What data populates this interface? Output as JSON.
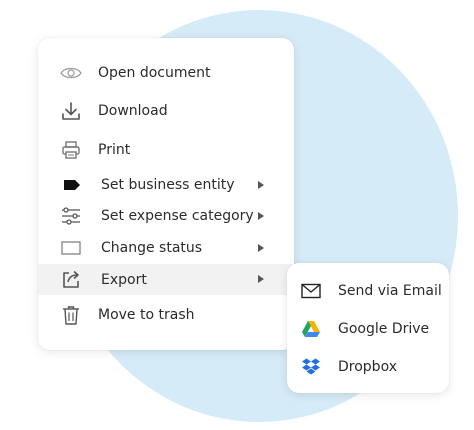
{
  "colors": {
    "background_circle": "#d6ebf8",
    "text": "#2b2b2b",
    "icon": "#555555",
    "highlight": "#f2f2f2",
    "dropbox": "#1f6fe0"
  },
  "menu": {
    "items": [
      {
        "label": "Open document",
        "icon": "eye-icon"
      },
      {
        "label": "Download",
        "icon": "download-icon"
      },
      {
        "label": "Print",
        "icon": "printer-icon"
      },
      {
        "label": "Set business entity",
        "icon": "tag-icon",
        "has_submenu": true
      },
      {
        "label": "Set expense category",
        "icon": "sliders-icon",
        "has_submenu": true
      },
      {
        "label": "Change status",
        "icon": "status-box-icon",
        "has_submenu": true
      },
      {
        "label": "Export",
        "icon": "share-icon",
        "has_submenu": true,
        "active": true
      },
      {
        "label": "Move to trash",
        "icon": "trash-icon"
      }
    ]
  },
  "submenu": {
    "items": [
      {
        "label": "Send via Email",
        "icon": "envelope-icon"
      },
      {
        "label": "Google Drive",
        "icon": "google-drive-icon"
      },
      {
        "label": "Dropbox",
        "icon": "dropbox-icon"
      }
    ]
  }
}
